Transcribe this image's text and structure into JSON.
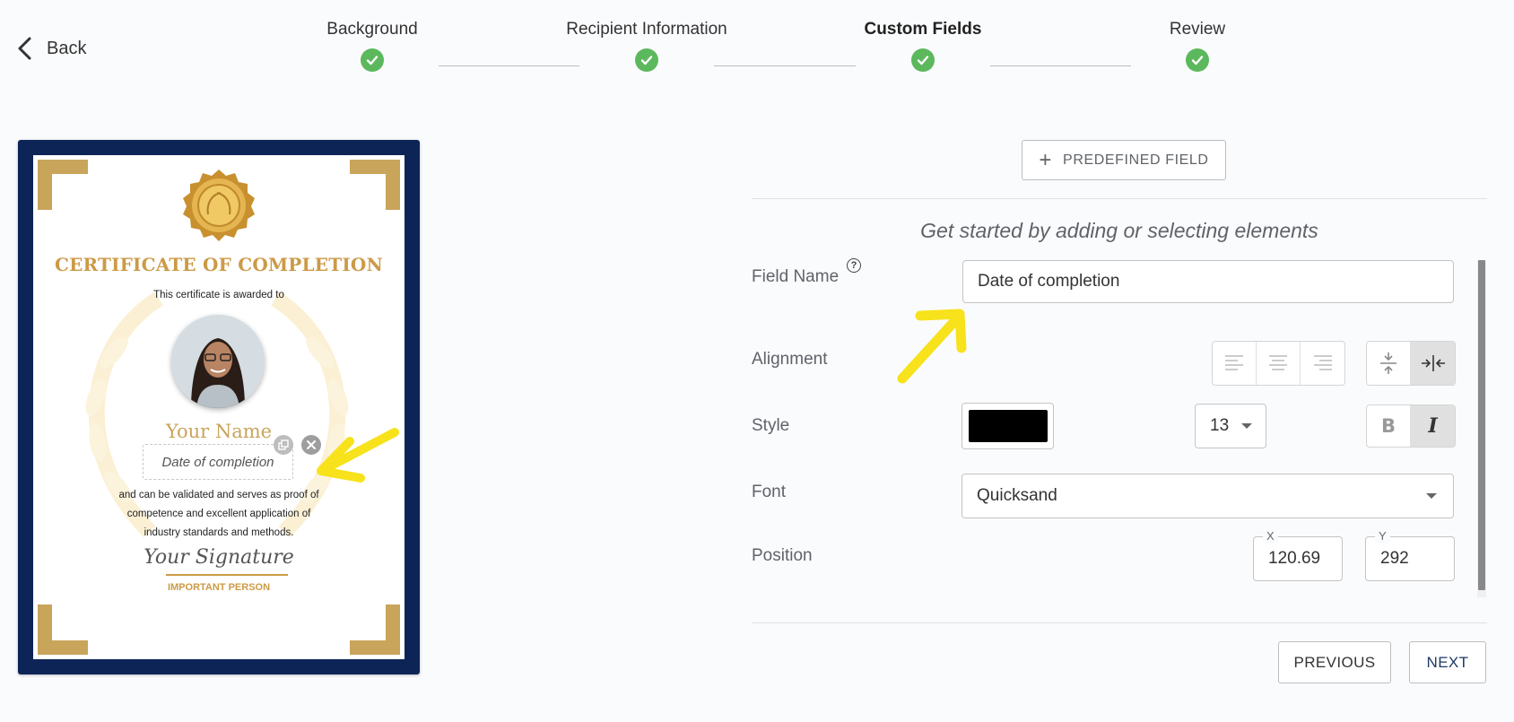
{
  "header": {
    "back_label": "Back",
    "steps": [
      {
        "label": "Background",
        "completed": true,
        "active": false
      },
      {
        "label": "Recipient Information",
        "completed": true,
        "active": false
      },
      {
        "label": "Custom Fields",
        "completed": true,
        "active": true
      },
      {
        "label": "Review",
        "completed": true,
        "active": false
      }
    ],
    "step_color": "#5cb85c"
  },
  "certificate": {
    "title": "CERTIFICATE OF COMPLETION",
    "awarded_text": "This certificate is awarded to",
    "recipient_name": "Your Name",
    "selected_field_text": "Date of completion",
    "body_lines": [
      "and can be validated and serves as proof of",
      "competence and excellent application of",
      "industry standards and methods."
    ],
    "signature_text": "Your Signature",
    "signer_title": "IMPORTANT PERSON",
    "border_color": "#0d2456",
    "accent_color": "#c9a45b"
  },
  "panel": {
    "predefined_button": "PREDEFINED FIELD",
    "hint": "Get started by adding or selecting elements",
    "labels": {
      "field_name": "Field Name",
      "alignment": "Alignment",
      "style": "Style",
      "font": "Font",
      "position": "Position"
    },
    "help_glyph": "?",
    "field_name_value": "Date of completion",
    "alignment": {
      "horizontal_options": [
        "align-left-icon",
        "align-center-icon",
        "align-right-icon"
      ],
      "vertical_options": [
        "vertical-center-icon",
        "horizontal-center-icon"
      ],
      "vertical_selected": "horizontal-center-icon"
    },
    "style": {
      "color": "#000000",
      "size": "13",
      "bold_glyph": "B",
      "italic_glyph": "I",
      "bold": false,
      "italic": true
    },
    "font_value": "Quicksand",
    "position": {
      "x_label": "X",
      "x": "120.69",
      "y_label": "Y",
      "y": "292"
    }
  },
  "footer": {
    "previous": "PREVIOUS",
    "next": "NEXT"
  },
  "annotation_color": "#f7e21b"
}
